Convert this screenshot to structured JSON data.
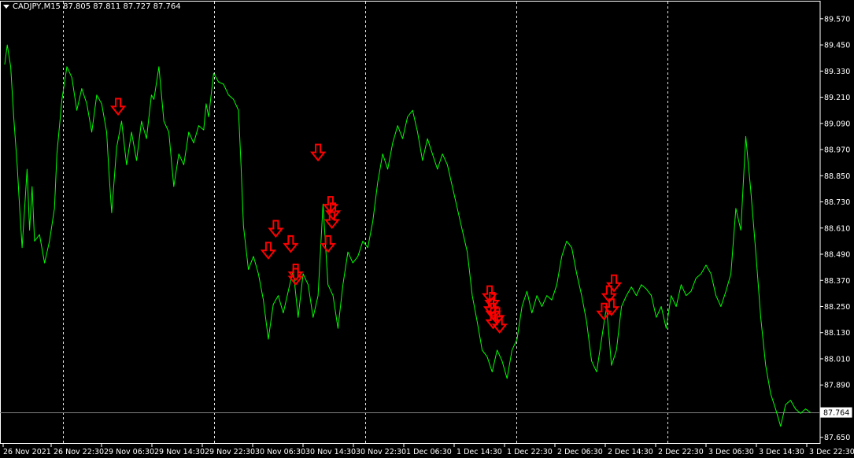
{
  "header": {
    "symbol": "CADJPY,M15",
    "ohlc": "87.805 87.811 87.727 87.764"
  },
  "colors": {
    "background": "#000000",
    "line": "#00ff00",
    "arrow": "#ff0000",
    "grid": "#ffffff",
    "axis": "#ffffff",
    "last_price_line": "#808080"
  },
  "chart_data": {
    "type": "line",
    "x_tick_labels": [
      "26 Nov 2021",
      "26 Nov 22:30",
      "29 Nov 06:30",
      "29 Nov 14:30",
      "29 Nov 22:30",
      "30 Nov 06:30",
      "30 Nov 14:30",
      "30 Nov 22:30",
      "1 Dec 06:30",
      "1 Dec 14:30",
      "1 Dec 22:30",
      "2 Dec 06:30",
      "2 Dec 14:30",
      "2 Dec 22:30",
      "3 Dec 06:30",
      "3 Dec 14:30",
      "3 Dec 22:30"
    ],
    "y_tick_labels": [
      "89.570",
      "89.450",
      "89.330",
      "89.210",
      "89.090",
      "88.970",
      "88.850",
      "88.730",
      "88.610",
      "88.490",
      "88.370",
      "88.250",
      "88.130",
      "88.010",
      "87.890",
      "87.764",
      "87.650"
    ],
    "y_ticks": [
      89.57,
      89.45,
      89.33,
      89.21,
      89.09,
      88.97,
      88.85,
      88.73,
      88.61,
      88.49,
      88.37,
      88.25,
      88.13,
      88.01,
      87.89,
      87.65
    ],
    "ylim": [
      87.62,
      89.62
    ],
    "last_price": 87.764,
    "last_price_label": "87.764",
    "grid_day_separators": [
      1,
      4,
      7,
      10,
      13
    ],
    "x_range": [
      0,
      16.3
    ],
    "series": [
      {
        "color": "#00ff00",
        "points": [
          [
            0.0,
            89.36
          ],
          [
            0.05,
            89.45
          ],
          [
            0.12,
            89.35
          ],
          [
            0.18,
            89.12
          ],
          [
            0.25,
            88.9
          ],
          [
            0.3,
            88.7
          ],
          [
            0.35,
            88.52
          ],
          [
            0.4,
            88.7
          ],
          [
            0.45,
            88.88
          ],
          [
            0.5,
            88.6
          ],
          [
            0.55,
            88.8
          ],
          [
            0.6,
            88.55
          ],
          [
            0.7,
            88.58
          ],
          [
            0.8,
            88.45
          ],
          [
            0.9,
            88.55
          ],
          [
            1.0,
            88.7
          ],
          [
            1.05,
            88.95
          ],
          [
            1.15,
            89.2
          ],
          [
            1.25,
            89.35
          ],
          [
            1.35,
            89.3
          ],
          [
            1.45,
            89.15
          ],
          [
            1.55,
            89.25
          ],
          [
            1.65,
            89.18
          ],
          [
            1.75,
            89.05
          ],
          [
            1.85,
            89.22
          ],
          [
            1.95,
            89.18
          ],
          [
            2.05,
            89.05
          ],
          [
            2.1,
            88.85
          ],
          [
            2.15,
            88.68
          ],
          [
            2.25,
            88.98
          ],
          [
            2.35,
            89.1
          ],
          [
            2.45,
            88.9
          ],
          [
            2.55,
            89.05
          ],
          [
            2.65,
            88.92
          ],
          [
            2.75,
            89.1
          ],
          [
            2.85,
            89.02
          ],
          [
            2.95,
            89.22
          ],
          [
            3.0,
            89.2
          ],
          [
            3.1,
            89.35
          ],
          [
            3.2,
            89.1
          ],
          [
            3.3,
            89.05
          ],
          [
            3.4,
            88.8
          ],
          [
            3.5,
            88.95
          ],
          [
            3.6,
            88.9
          ],
          [
            3.7,
            89.05
          ],
          [
            3.8,
            89.0
          ],
          [
            3.9,
            89.08
          ],
          [
            4.0,
            89.06
          ],
          [
            4.05,
            89.18
          ],
          [
            4.1,
            89.12
          ],
          [
            4.2,
            89.32
          ],
          [
            4.3,
            89.28
          ],
          [
            4.4,
            89.27
          ],
          [
            4.5,
            89.22
          ],
          [
            4.6,
            89.2
          ],
          [
            4.7,
            89.15
          ],
          [
            4.75,
            88.9
          ],
          [
            4.8,
            88.62
          ],
          [
            4.9,
            88.42
          ],
          [
            5.0,
            88.48
          ],
          [
            5.1,
            88.4
          ],
          [
            5.2,
            88.28
          ],
          [
            5.3,
            88.1
          ],
          [
            5.4,
            88.26
          ],
          [
            5.5,
            88.3
          ],
          [
            5.6,
            88.22
          ],
          [
            5.7,
            88.32
          ],
          [
            5.8,
            88.42
          ],
          [
            5.9,
            88.2
          ],
          [
            6.0,
            88.4
          ],
          [
            6.1,
            88.35
          ],
          [
            6.2,
            88.2
          ],
          [
            6.3,
            88.3
          ],
          [
            6.4,
            88.72
          ],
          [
            6.5,
            88.35
          ],
          [
            6.6,
            88.3
          ],
          [
            6.7,
            88.15
          ],
          [
            6.8,
            88.35
          ],
          [
            6.9,
            88.5
          ],
          [
            7.0,
            88.45
          ],
          [
            7.1,
            88.48
          ],
          [
            7.2,
            88.55
          ],
          [
            7.3,
            88.52
          ],
          [
            7.4,
            88.64
          ],
          [
            7.5,
            88.82
          ],
          [
            7.6,
            88.95
          ],
          [
            7.7,
            88.88
          ],
          [
            7.8,
            89.0
          ],
          [
            7.9,
            89.08
          ],
          [
            8.0,
            89.02
          ],
          [
            8.1,
            89.12
          ],
          [
            8.2,
            89.15
          ],
          [
            8.3,
            89.05
          ],
          [
            8.4,
            88.92
          ],
          [
            8.5,
            89.02
          ],
          [
            8.6,
            88.95
          ],
          [
            8.7,
            88.88
          ],
          [
            8.8,
            88.95
          ],
          [
            8.9,
            88.9
          ],
          [
            9.0,
            88.8
          ],
          [
            9.1,
            88.7
          ],
          [
            9.2,
            88.6
          ],
          [
            9.3,
            88.5
          ],
          [
            9.4,
            88.3
          ],
          [
            9.5,
            88.18
          ],
          [
            9.6,
            88.05
          ],
          [
            9.7,
            88.02
          ],
          [
            9.8,
            87.95
          ],
          [
            9.9,
            88.05
          ],
          [
            10.0,
            88.0
          ],
          [
            10.1,
            87.92
          ],
          [
            10.2,
            88.05
          ],
          [
            10.3,
            88.1
          ],
          [
            10.4,
            88.25
          ],
          [
            10.5,
            88.32
          ],
          [
            10.6,
            88.22
          ],
          [
            10.7,
            88.3
          ],
          [
            10.8,
            88.25
          ],
          [
            10.9,
            88.3
          ],
          [
            11.0,
            88.28
          ],
          [
            11.1,
            88.35
          ],
          [
            11.2,
            88.48
          ],
          [
            11.3,
            88.55
          ],
          [
            11.4,
            88.52
          ],
          [
            11.5,
            88.4
          ],
          [
            11.6,
            88.3
          ],
          [
            11.7,
            88.18
          ],
          [
            11.8,
            88.0
          ],
          [
            11.9,
            87.95
          ],
          [
            12.0,
            88.1
          ],
          [
            12.1,
            88.25
          ],
          [
            12.2,
            87.98
          ],
          [
            12.3,
            88.05
          ],
          [
            12.4,
            88.25
          ],
          [
            12.5,
            88.3
          ],
          [
            12.6,
            88.34
          ],
          [
            12.7,
            88.3
          ],
          [
            12.8,
            88.35
          ],
          [
            12.9,
            88.33
          ],
          [
            13.0,
            88.3
          ],
          [
            13.1,
            88.2
          ],
          [
            13.2,
            88.25
          ],
          [
            13.3,
            88.15
          ],
          [
            13.4,
            88.3
          ],
          [
            13.5,
            88.25
          ],
          [
            13.6,
            88.35
          ],
          [
            13.7,
            88.3
          ],
          [
            13.8,
            88.32
          ],
          [
            13.9,
            88.38
          ],
          [
            14.0,
            88.4
          ],
          [
            14.1,
            88.44
          ],
          [
            14.2,
            88.4
          ],
          [
            14.3,
            88.3
          ],
          [
            14.4,
            88.25
          ],
          [
            14.5,
            88.32
          ],
          [
            14.6,
            88.4
          ],
          [
            14.7,
            88.7
          ],
          [
            14.8,
            88.6
          ],
          [
            14.9,
            89.03
          ],
          [
            15.0,
            88.78
          ],
          [
            15.1,
            88.5
          ],
          [
            15.2,
            88.2
          ],
          [
            15.3,
            87.98
          ],
          [
            15.4,
            87.85
          ],
          [
            15.5,
            87.78
          ],
          [
            15.6,
            87.7
          ],
          [
            15.7,
            87.8
          ],
          [
            15.8,
            87.82
          ],
          [
            15.9,
            87.78
          ],
          [
            16.0,
            87.76
          ],
          [
            16.1,
            87.78
          ],
          [
            16.2,
            87.764
          ]
        ]
      }
    ],
    "sell_arrows": [
      [
        2.28,
        89.16
      ],
      [
        5.3,
        88.5
      ],
      [
        5.45,
        88.6
      ],
      [
        5.75,
        88.53
      ],
      [
        5.85,
        88.4
      ],
      [
        5.85,
        88.38
      ],
      [
        6.3,
        88.95
      ],
      [
        6.5,
        88.53
      ],
      [
        6.55,
        88.71
      ],
      [
        6.6,
        88.68
      ],
      [
        6.58,
        88.64
      ],
      [
        9.75,
        88.3
      ],
      [
        9.8,
        88.27
      ],
      [
        9.78,
        88.24
      ],
      [
        9.82,
        88.22
      ],
      [
        9.82,
        88.18
      ],
      [
        9.9,
        88.2
      ],
      [
        9.95,
        88.16
      ],
      [
        12.05,
        88.22
      ],
      [
        12.15,
        88.3
      ],
      [
        12.2,
        88.24
      ],
      [
        12.25,
        88.35
      ]
    ]
  }
}
